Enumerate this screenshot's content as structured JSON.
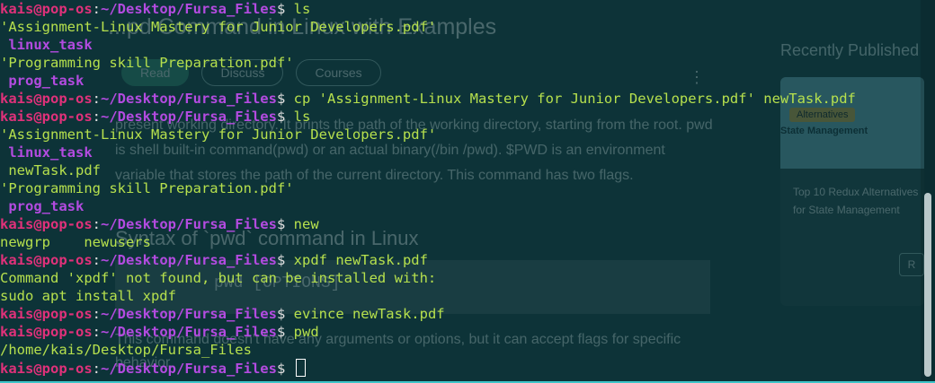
{
  "background_page": {
    "heading": "...pd Command in Linux with Examples",
    "tabs": [
      "Read",
      "Discuss",
      "Courses"
    ],
    "paragraph": "present working directory. It prints the path of the working directory, starting from the root. pwd is shell built-in command(pwd) or an actual binary(/bin /pwd). $PWD is an environment variable that stores the path of the current directory. This command has two flags.",
    "link_text": "environment variable",
    "section_heading": "Syntax of `pwd` command in Linux",
    "code_text": "pwd [OPTIONS]",
    "paragraph2": "This command doesn't have any arguments or options, but it can accept flags for specific behavior.",
    "aside_title": "Recently Published",
    "card_badge": "Alternatives",
    "card_image_text": "State Management",
    "card_title": "Top 10 Redux Alternatives for State Management"
  },
  "prompt": {
    "user": "kais@pop-os",
    "path": "~/Desktop/Fursa_Files",
    "symbol": "$"
  },
  "lines": [
    {
      "type": "prompt",
      "cmd": "ls"
    },
    {
      "type": "out",
      "text": "'Assignment-Linux Mastery for Junior Developers.pdf'"
    },
    {
      "type": "dir",
      "text": " linux_task"
    },
    {
      "type": "out",
      "text": "'Programming skill Preparation.pdf'"
    },
    {
      "type": "dir",
      "text": " prog_task"
    },
    {
      "type": "prompt",
      "cmd": "cp 'Assignment-Linux Mastery for Junior Developers.pdf' newTask.pdf"
    },
    {
      "type": "prompt",
      "cmd": "ls"
    },
    {
      "type": "out",
      "text": "'Assignment-Linux Mastery for Junior Developers.pdf'"
    },
    {
      "type": "dir",
      "text": " linux_task"
    },
    {
      "type": "out",
      "text": " newTask.pdf"
    },
    {
      "type": "out",
      "text": "'Programming skill Preparation.pdf'"
    },
    {
      "type": "dir",
      "text": " prog_task"
    },
    {
      "type": "prompt",
      "cmd": "new"
    },
    {
      "type": "out",
      "text": "newgrp    newusers"
    },
    {
      "type": "prompt",
      "cmd": "xpdf newTask.pdf"
    },
    {
      "type": "out",
      "text": "Command 'xpdf' not found, but can be installed with:"
    },
    {
      "type": "out",
      "text": "sudo apt install xpdf"
    },
    {
      "type": "prompt",
      "cmd": "evince newTask.pdf"
    },
    {
      "type": "prompt",
      "cmd": "pwd"
    },
    {
      "type": "out",
      "text": "/home/kais/Desktop/Fursa_Files"
    },
    {
      "type": "prompt",
      "cmd": ""
    }
  ],
  "colors": {
    "user": "#e0317a",
    "path": "#b34be0",
    "output": "#b6e04d",
    "background": "#0d3338"
  }
}
